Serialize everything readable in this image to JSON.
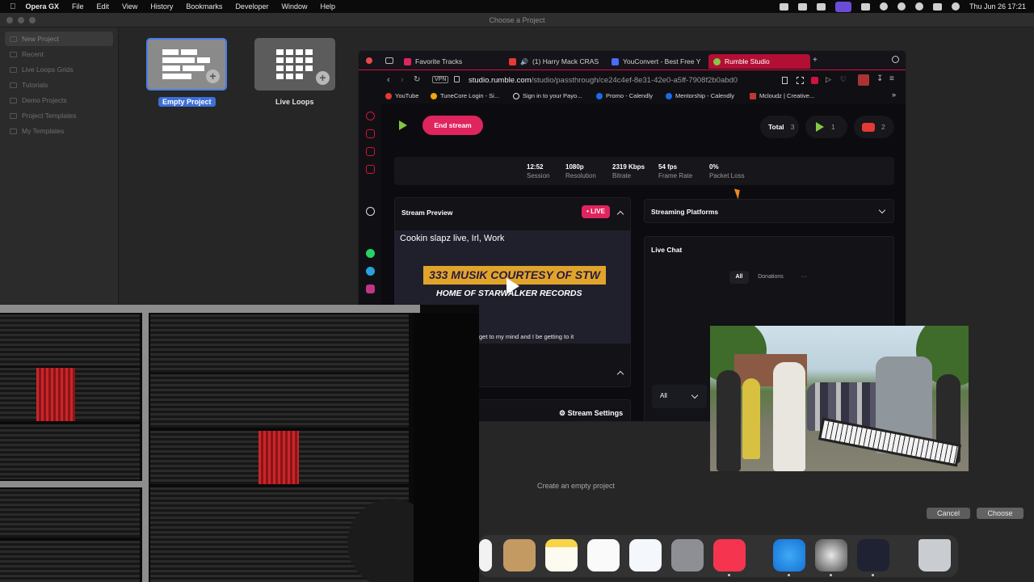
{
  "menubar": {
    "app": "Opera GX",
    "items": [
      "File",
      "Edit",
      "View",
      "History",
      "Bookmarks",
      "Developer",
      "Window",
      "Help"
    ],
    "clock": "Thu Jun 26  17:21"
  },
  "chooser": {
    "title": "Choose a Project",
    "sidebar": [
      "New Project",
      "Recent",
      "Live Loops Grids",
      "Tutorials",
      "Demo Projects",
      "Project Templates",
      "My Templates"
    ],
    "templates": [
      {
        "label": "Empty Project"
      },
      {
        "label": "Live Loops"
      }
    ],
    "footer_text": "Create an empty project",
    "cancel": "Cancel",
    "choose": "Choose"
  },
  "browser": {
    "tabs": [
      {
        "label": "Favorite Tracks",
        "color": "#e0245e"
      },
      {
        "label": "(1) Harry Mack CRAS",
        "color": "#e53935"
      },
      {
        "label": "YouConvert - Best Free Y",
        "color": "#4a6cf7"
      },
      {
        "label": "Rumble Studio",
        "color": "#85c742"
      }
    ],
    "vpn": "VPN",
    "url_domain": "studio.rumble.com",
    "url_path": "/studio/passthrough/ce24c4ef-8e31-42e0-a5ff-7908f2b0abd0",
    "bookmarks": [
      {
        "label": "YouTube",
        "color": "#e53935"
      },
      {
        "label": "TuneCore Login - Si...",
        "color": "#f2a900"
      },
      {
        "label": "Sign in to your Payo...",
        "color": "#e8e8e8"
      },
      {
        "label": "Promo - Calendly",
        "color": "#1a6bf0"
      },
      {
        "label": "Mentorship - Calendly",
        "color": "#1a6bf0"
      },
      {
        "label": "Mcloudz | Creative...",
        "color": "#c0392b"
      }
    ]
  },
  "rumble": {
    "end_stream": "End stream",
    "total_label": "Total",
    "total_count": "3",
    "rumble_count": "1",
    "youtube_count": "2",
    "stats": [
      {
        "value": "12:52",
        "label": "Session"
      },
      {
        "value": "1080p",
        "label": "Resolution"
      },
      {
        "value": "2319 Kbps",
        "label": "Bitrate"
      },
      {
        "value": "54 fps",
        "label": "Frame Rate"
      },
      {
        "value": "0%",
        "label": "Packet Loss"
      }
    ],
    "stream_preview": "Stream Preview",
    "live": "• LIVE",
    "video_title": "Cookin slapz live, Irl, Work",
    "banner_line1": "333 MUSIK COURTESY OF STW",
    "banner_line2": "HOME OF STARWALKER RECORDS",
    "caption": "get to my mind and I be getting to it",
    "streaming_platforms": "Streaming Platforms",
    "live_chat": "Live Chat",
    "chat_tabs": [
      "All",
      "Donations"
    ],
    "chat_more": "···",
    "all_dropdown": "All",
    "stream_settings": "Stream Settings"
  },
  "colors": {
    "rumble_green": "#85c742",
    "rumble_pink": "#e0245e",
    "opera_red": "#d0123e",
    "logic_blue": "#3c6fd8"
  }
}
